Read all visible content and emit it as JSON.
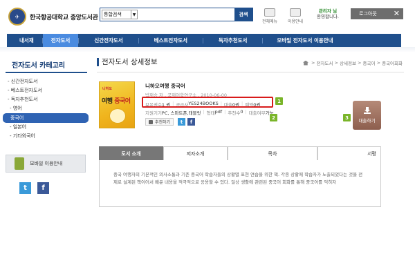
{
  "header": {
    "logo_text": "한국항공대학교 중앙도서관",
    "search": {
      "selected_option": "통합검색",
      "value": "",
      "button_label": "검색"
    },
    "util_menu_label": "전체메뉴",
    "util_info_label": "이용안내",
    "admin_name": "관리자 님",
    "admin_welcome": "환영합니다.",
    "logout_label": "로그아웃",
    "close_symbol": "✕"
  },
  "nav": {
    "items": [
      {
        "label": "내서재"
      },
      {
        "label": "전자도서"
      },
      {
        "label": "신간전자도서"
      },
      {
        "label": "베스트전자도서"
      },
      {
        "label": "독자추천도서"
      },
      {
        "label": "모바일 전자도서 이용안내"
      }
    ],
    "active_index": 1
  },
  "sidebar": {
    "title": "전자도서 카테고리",
    "items": [
      {
        "label": "- 신간전자도서"
      },
      {
        "label": "- 베스트전자도서"
      },
      {
        "label": "- 독자추천도서"
      },
      {
        "label": "- 영어"
      },
      {
        "label": "중국어"
      },
      {
        "label": "- 일본어"
      },
      {
        "label": "- 기타외국어"
      }
    ],
    "mobile_label": "모바일 이용안내",
    "twitter_symbol": "t",
    "facebook_symbol": "f"
  },
  "content": {
    "page_title": "전자도서 상세정보",
    "breadcrumb": [
      "전자도서",
      "상세정보",
      "중국어",
      "중국어회화"
    ],
    "breadcrumb_sep": ">",
    "cover": {
      "small_text": "니하오",
      "title_a": "여행 ",
      "title_b": "중국어"
    },
    "book_title": "니하오여행 중국어",
    "book_meta": "박재승 저 , 국제어학연구소 , 2010-06-00",
    "holdings": [
      {
        "label": "보유권수 ",
        "value": "1 권"
      },
      {
        "label": "공급사 ",
        "value": "YES24BOOKS"
      },
      {
        "label": "대출 ",
        "value": "0권"
      },
      {
        "label": "예약 ",
        "value": "0권"
      }
    ],
    "support": [
      {
        "label": "지원기기 ",
        "value": "PC, 스마트폰,태블릿"
      },
      {
        "label": "형태 ",
        "value": "pdf"
      },
      {
        "label": "추천수 ",
        "value": "0"
      },
      {
        "label": "대출여부 ",
        "value": "가능"
      }
    ],
    "recommend_label": "추천하기",
    "share_twitter_symbol": "t",
    "share_facebook_symbol": "f",
    "badge_1": "1",
    "badge_2": "2",
    "badge_3": "3",
    "borrow_label": "대출하기",
    "tabs": [
      {
        "label": "도서 소개"
      },
      {
        "label": "저자소개"
      },
      {
        "label": "목차"
      },
      {
        "label": "서평"
      }
    ],
    "description": "중국 여행자의 기본적인 의사소통과 기존 중국어 학습자들의 상황별 표현 연습을 위한 책. 각종 상황에 학습자가 노출되었다는 것을 전제로 설계된 책이어서 배운 내용을 적극적으로 응용할 수 있다. 일상 생활에 관련된 중국어 회화를 통해 중국어를 익히자"
  },
  "colors": {
    "nav_bg": "#1f4f8c",
    "nav_active": "#4a8be0",
    "highlight_box": "#d81b1b",
    "badge": "#7ab52a",
    "borrow_button": "#8d5e4e"
  }
}
